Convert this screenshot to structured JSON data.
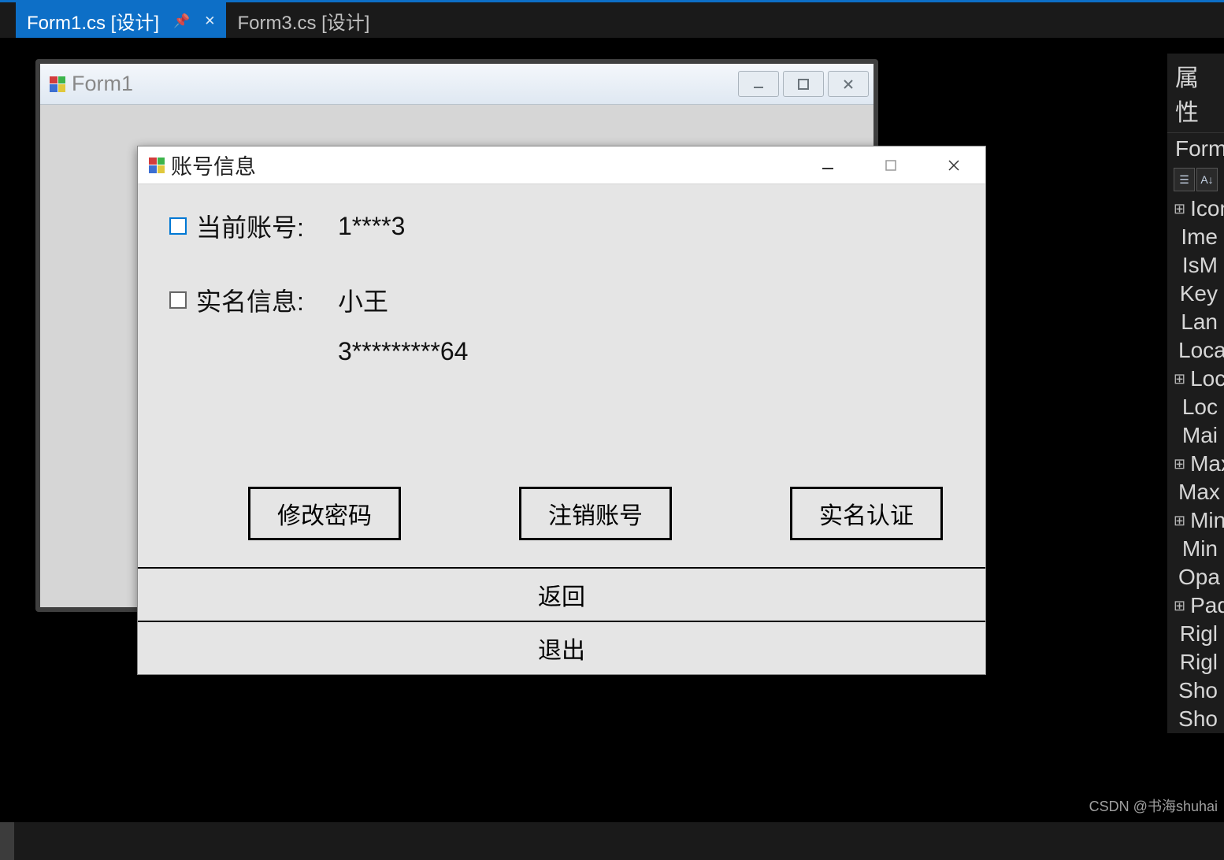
{
  "tabs": [
    {
      "label": "Form1.cs [设计]",
      "active": true,
      "pinnable": true
    },
    {
      "label": "Form3.cs [设计]",
      "active": false,
      "pinnable": false
    }
  ],
  "form1": {
    "title": "Form1"
  },
  "dialog": {
    "title": "账号信息",
    "rows": {
      "account_label": "当前账号:",
      "account_value": "1****3",
      "realname_label": "实名信息:",
      "realname_name": "小王",
      "realname_id": "3*********64"
    },
    "actions": {
      "change_pwd": "修改密码",
      "deregister": "注销账号",
      "realname_auth": "实名认证",
      "back": "返回",
      "exit": "退出"
    }
  },
  "properties": {
    "header": "属性",
    "object": "Form",
    "items": [
      "Icon",
      "Ime",
      "IsM",
      "Key",
      "Lan",
      "Loca",
      "Loca",
      "Loc",
      "Mai",
      "Max",
      "Max",
      "Min",
      "Min",
      "Opa",
      "Pad",
      "Rigl",
      "Rigl",
      "Sho",
      "Sho"
    ],
    "expandable": [
      0,
      6,
      9,
      11,
      14
    ]
  },
  "watermark": "CSDN @书海shuhai"
}
